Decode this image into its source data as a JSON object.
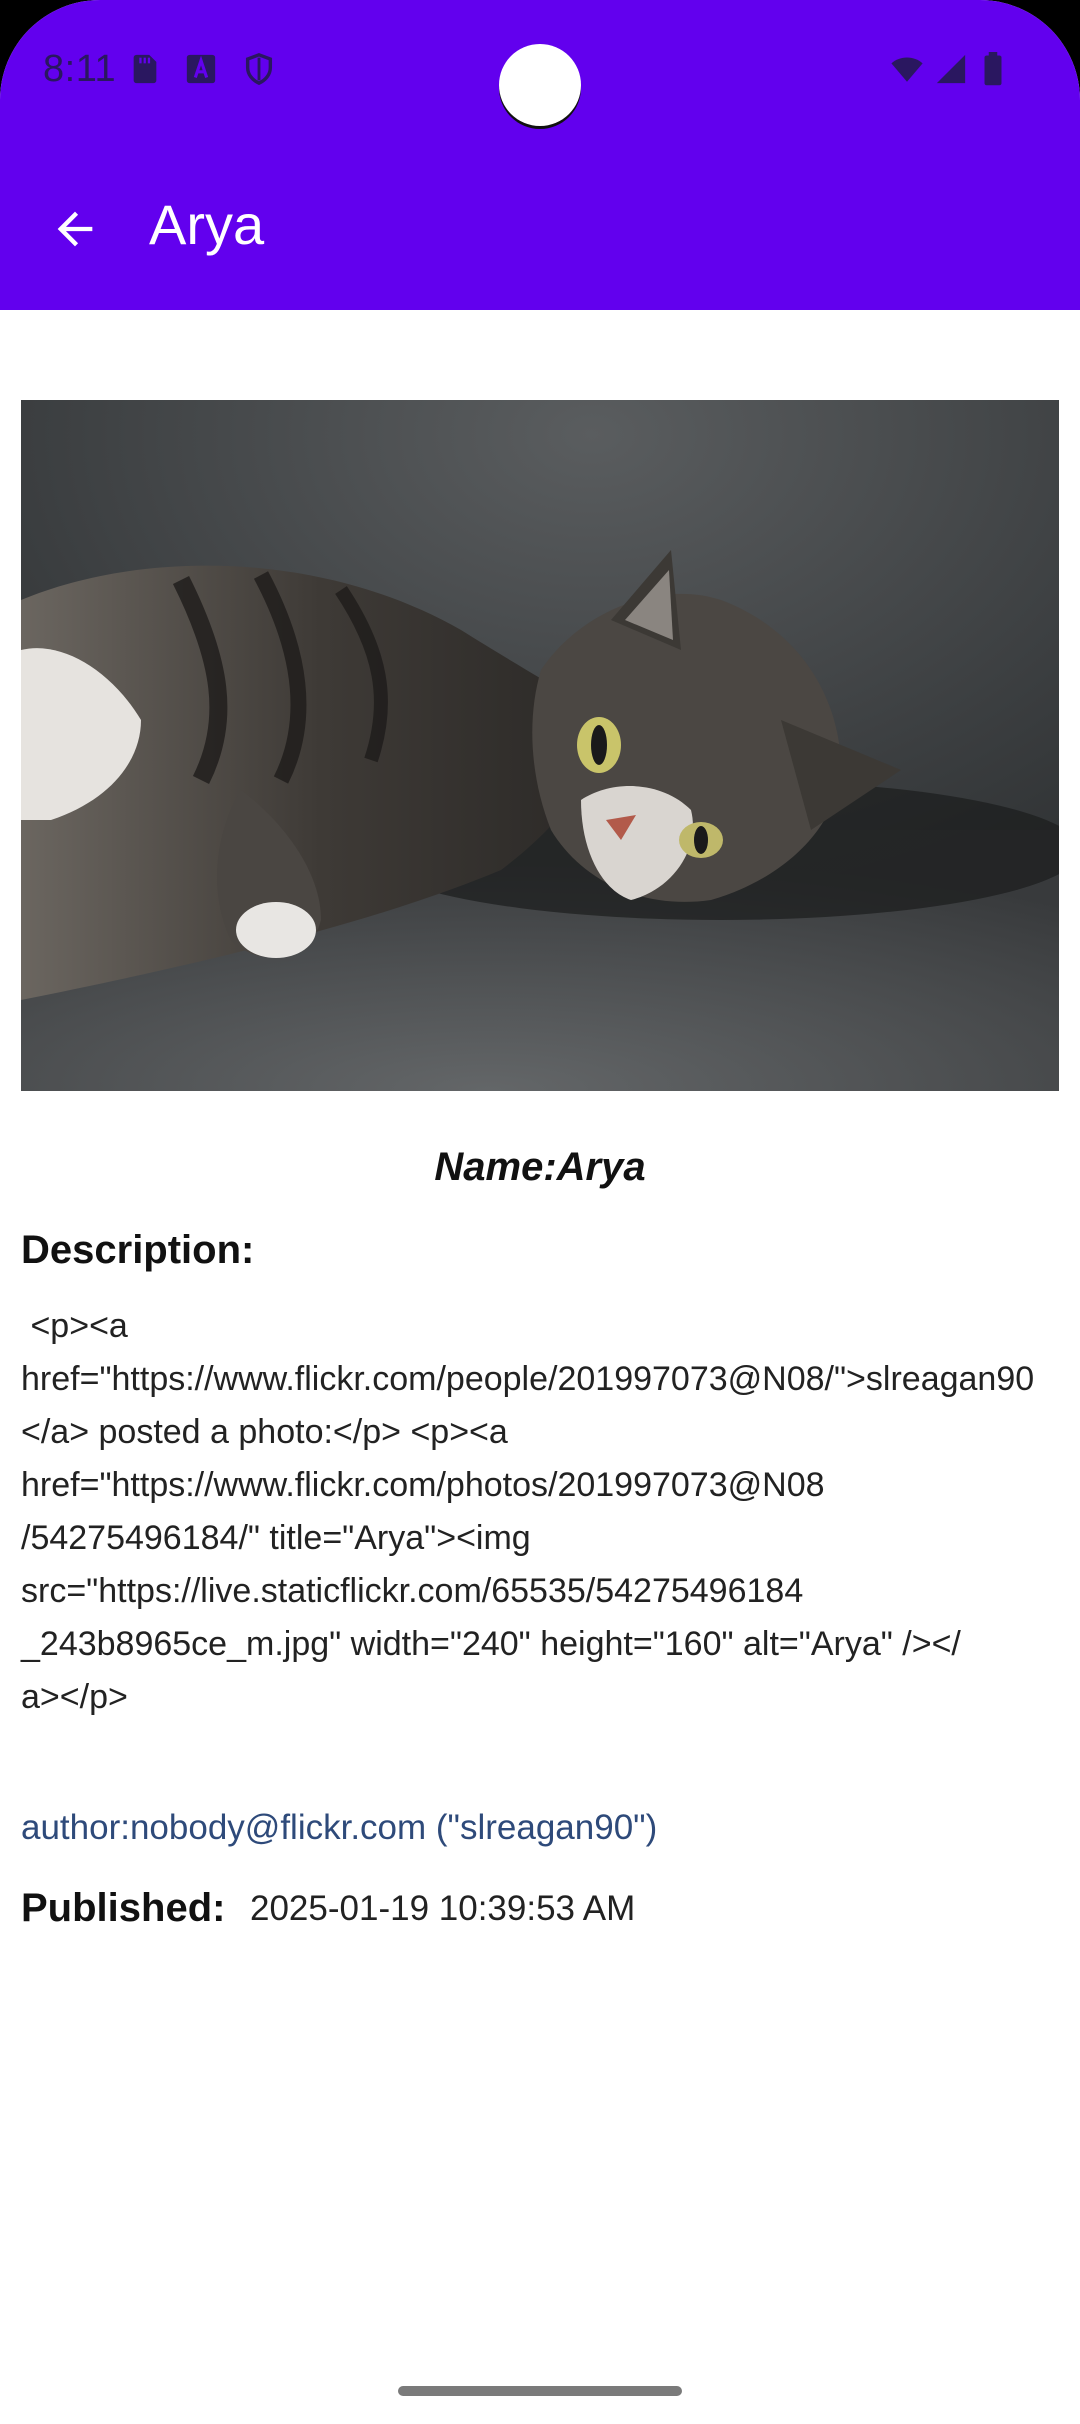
{
  "status_bar": {
    "time": "8:11",
    "icons": [
      "sd-card-icon",
      "keyboard-a-icon",
      "shield-icon",
      "wifi-icon",
      "signal-icon",
      "battery-icon"
    ]
  },
  "app_bar": {
    "title": "Arya",
    "back_icon": "arrow-back-icon",
    "color": "#6200EE"
  },
  "detail": {
    "photo_alt": "Arya",
    "name_line": "Name:Arya",
    "description_label": "Description:",
    "description_text": " <p><a\nhref=\"https://www.flickr.com/people/201997073@N08/\">slreagan90</a> posted a photo:</p> <p><a\nhref=\"https://www.flickr.com/photos/201997073@N08\n/54275496184/\" title=\"Arya\"><img\nsrc=\"https://live.staticflickr.com/65535/54275496184\n_243b8965ce_m.jpg\" width=\"240\" height=\"160\" alt=\"Arya\" /></\na></p>",
    "author": "author:nobody@flickr.com (\"slreagan90\")",
    "published_label": "Published:",
    "published_value": "2025-01-19 10:39:53 AM"
  }
}
